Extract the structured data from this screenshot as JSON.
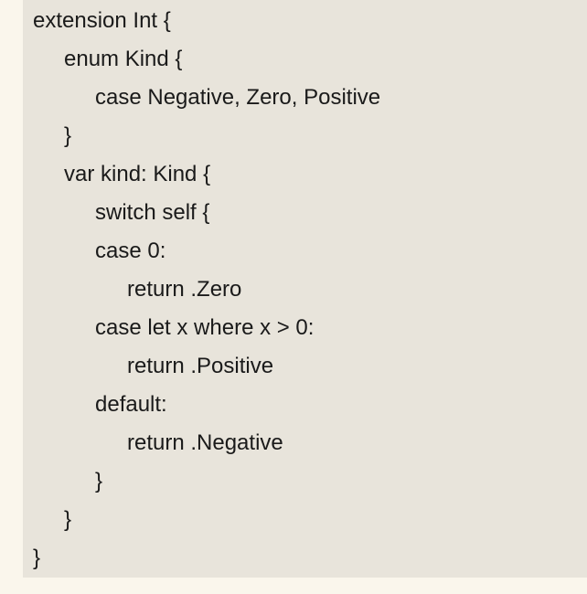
{
  "code": {
    "lines": [
      "extension Int {",
      "enum Kind {",
      "case Negative, Zero, Positive",
      "}",
      "var kind: Kind {",
      "switch self {",
      "case 0:",
      "return .Zero",
      "case let x where x > 0:",
      "return .Positive",
      "default:",
      "return .Negative",
      "}",
      "}",
      "}"
    ]
  }
}
